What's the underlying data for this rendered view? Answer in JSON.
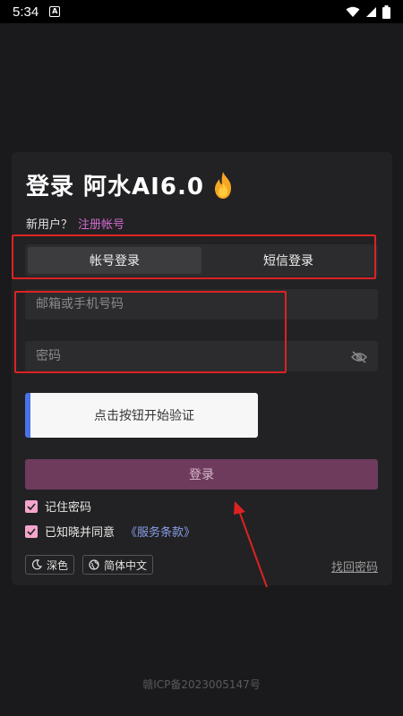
{
  "status": {
    "time": "5:34",
    "notif_icon": "A"
  },
  "card": {
    "title": "登录 阿水AI6.0",
    "signup_prompt": "新用户？",
    "signup_link": "注册帐号",
    "tabs": [
      {
        "label": "帐号登录",
        "active": true
      },
      {
        "label": "短信登录",
        "active": false
      }
    ],
    "email_placeholder": "邮箱或手机号码",
    "password_placeholder": "密码",
    "verify_label": "点击按钮开始验证",
    "login_label": "登录",
    "remember_label": "记住密码",
    "agree_label": "已知晓并同意",
    "terms_link": "《服务条款》",
    "theme_label": "深色",
    "language_label": "简体中文",
    "forgot_label": "找回密码"
  },
  "footer": {
    "icp": "赣ICP备2023005147号"
  },
  "colors": {
    "accent": "#d46ad1",
    "login_button": "#6e3b5c",
    "checkbox": "#f5a5cc",
    "link_blue": "#8a9ee8",
    "annotation_red": "#dd2222"
  },
  "icons": [
    "wifi-icon",
    "signal-icon",
    "battery-icon",
    "fire-icon",
    "eye-off-icon",
    "moon-icon",
    "globe-icon",
    "check-icon"
  ]
}
